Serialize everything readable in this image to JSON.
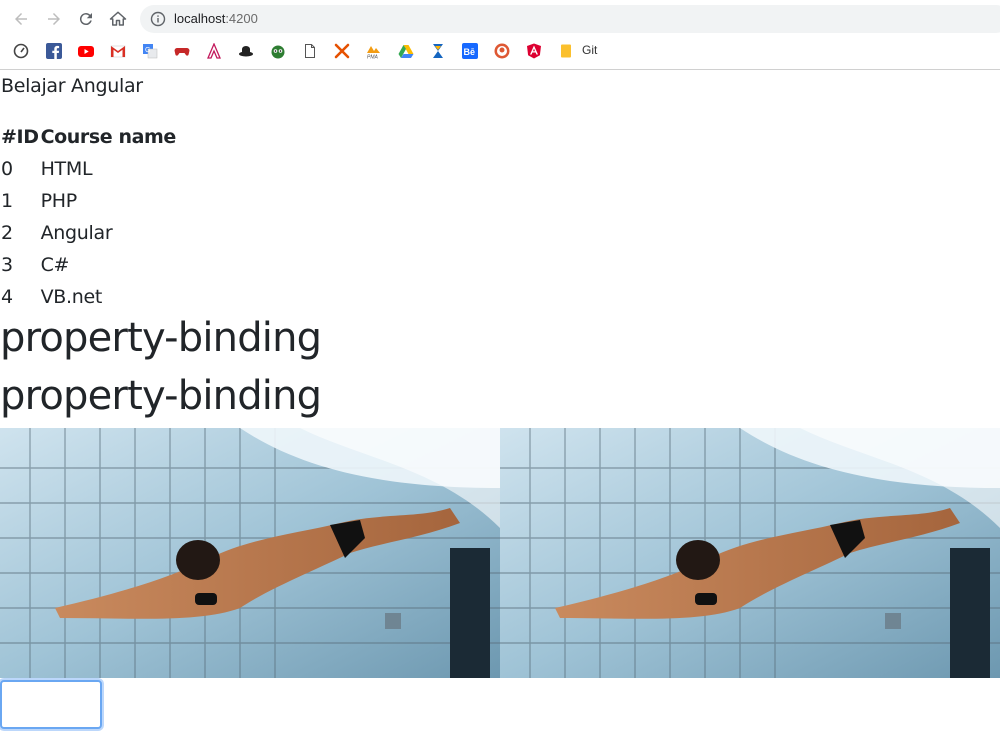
{
  "browser": {
    "url_host": "localhost",
    "url_port": ":4200",
    "bookmarks": [
      {
        "name": "speed-icon"
      },
      {
        "name": "facebook-icon",
        "color": "#3b5998"
      },
      {
        "name": "youtube-icon",
        "color": "#ff0000"
      },
      {
        "name": "gmail-icon",
        "color": "#d93025"
      },
      {
        "name": "translate-icon",
        "color": "#4285f4"
      },
      {
        "name": "gamepad-icon",
        "color": "#c62828"
      },
      {
        "name": "assassin-icon",
        "color": "#c2185b"
      },
      {
        "name": "hat-icon",
        "color": "#222222"
      },
      {
        "name": "monster-icon",
        "color": "#2e7d32"
      },
      {
        "name": "document-icon",
        "color": "#555555"
      },
      {
        "name": "x-icon",
        "color": "#e65100"
      },
      {
        "name": "phpmyadmin-icon",
        "color": "#f39c12"
      },
      {
        "name": "drive-icon",
        "color": "#34a853"
      },
      {
        "name": "hourglass-icon",
        "color": "#1565c0"
      },
      {
        "name": "behance-icon",
        "color": "#1769ff"
      },
      {
        "name": "duckduckgo-icon",
        "color": "#de5833"
      },
      {
        "name": "angular-icon",
        "color": "#dd0031"
      },
      {
        "name": "folder-icon",
        "color": "#fbc02d"
      }
    ],
    "bookmark_folder_label": "Git"
  },
  "app": {
    "title": "Belajar Angular",
    "table": {
      "headers": [
        "#ID",
        "Course name"
      ],
      "rows": [
        {
          "id": "0",
          "name": "HTML"
        },
        {
          "id": "1",
          "name": "PHP"
        },
        {
          "id": "2",
          "name": "Angular"
        },
        {
          "id": "3",
          "name": "C#"
        },
        {
          "id": "4",
          "name": "VB.net"
        }
      ]
    },
    "heading_1": "property-binding",
    "heading_2": "property-binding",
    "input_value": ""
  }
}
